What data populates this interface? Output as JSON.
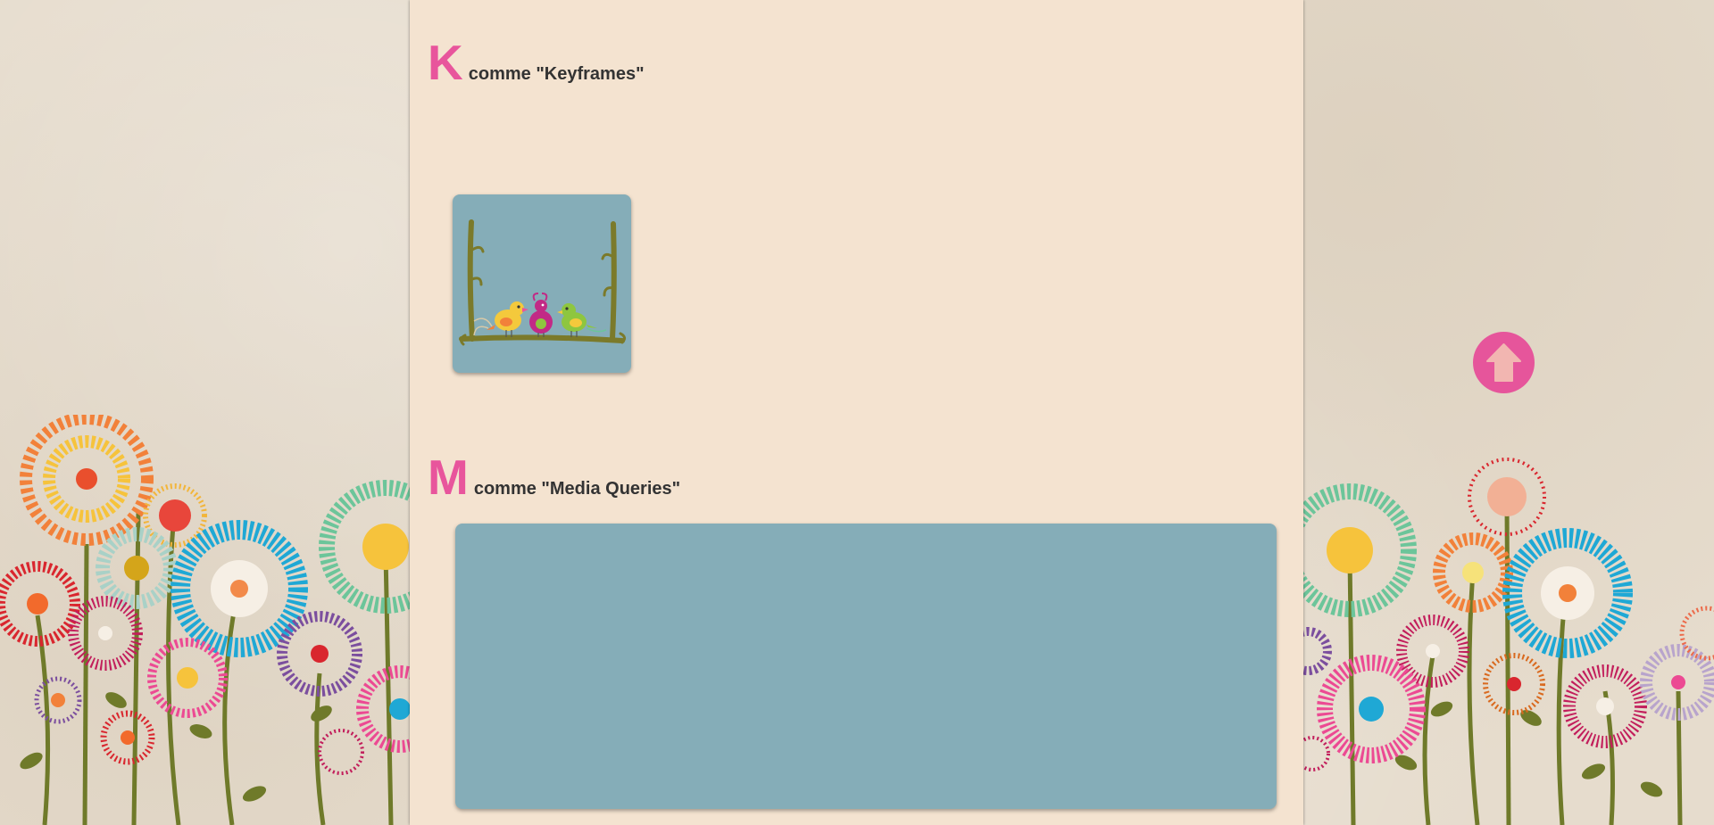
{
  "sections": [
    {
      "letter": "K",
      "rest": "comme \"Keyframes\""
    },
    {
      "letter": "M",
      "rest": "comme \"Media Queries\""
    }
  ],
  "colors": {
    "accent_pink": "#e8559c",
    "card_blue": "#85adb8",
    "panel_bg": "#f4e3d0",
    "branch": "#7b7a2a"
  },
  "icons": {
    "back_to_top": "arrow-up-icon",
    "birds": "birds-on-branch-icon",
    "flowers": "flower-meadow-decoration"
  }
}
